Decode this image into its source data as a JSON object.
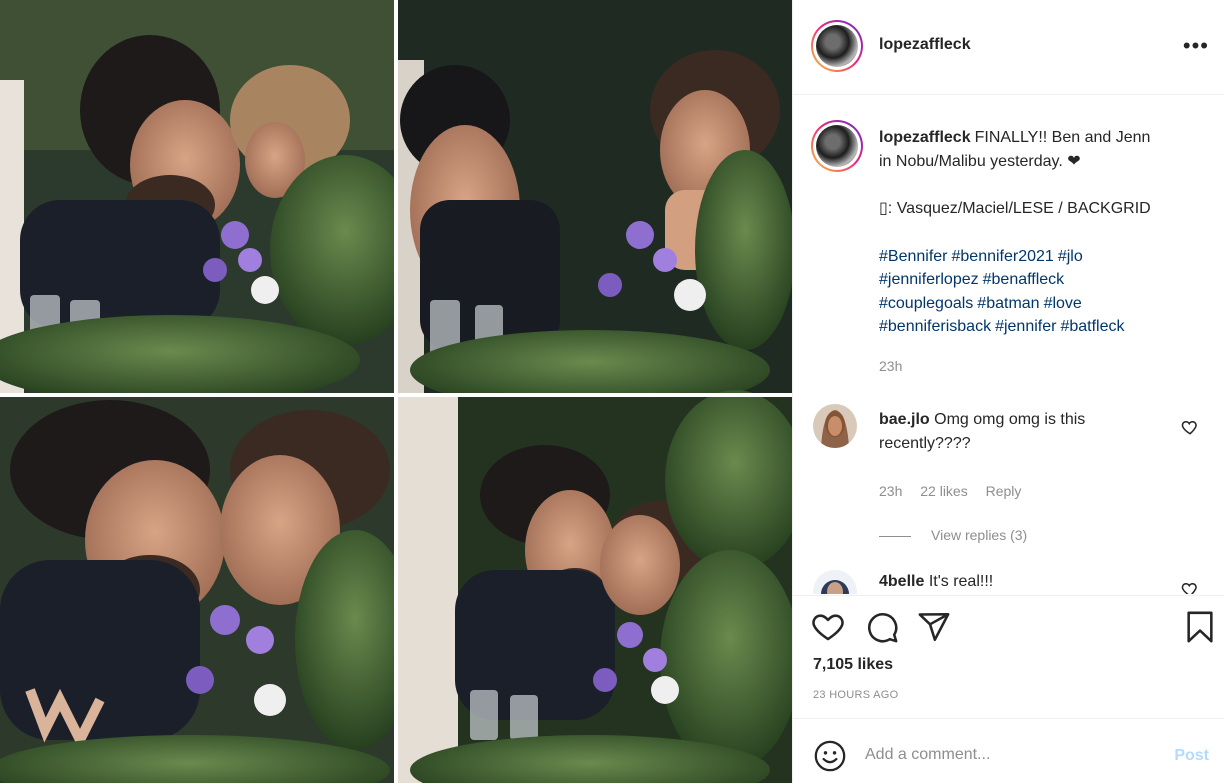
{
  "post": {
    "username": "lopezaffleck",
    "more_label": "•••",
    "caption_lines": [
      "FINALLY!! Ben and Jenn",
      "in Nobu/Malibu yesterday. ❤"
    ],
    "credit": "▯: Vasquez/Maciel/LESE / BACKGRID",
    "hashtag_lines": [
      [
        "#Bennifer",
        "#bennifer2021",
        "#jlo"
      ],
      [
        "#jenniferlopez",
        "#benaffleck"
      ],
      [
        "#couplegoals",
        "#batman",
        "#love"
      ],
      [
        "#benniferisback",
        "#jennifer",
        "#batfleck"
      ]
    ],
    "caption_time": "23h"
  },
  "comments": [
    {
      "username": "bae.jlo",
      "text": "Omg omg omg is this recently????",
      "time": "23h",
      "likes": "22 likes",
      "reply": "Reply",
      "view_replies": "View replies (3)"
    },
    {
      "username": "4belle",
      "text": "It's real!!!"
    }
  ],
  "actions": {
    "likes": "7,105 likes",
    "ago": "23 HOURS AGO",
    "icons": [
      "heart-icon",
      "comment-icon",
      "share-icon",
      "bookmark-icon"
    ]
  },
  "add_comment": {
    "placeholder": "Add a comment...",
    "post_label": "Post",
    "colors": {
      "post_disabled": "#b3dbff",
      "link": "#00376b",
      "meta": "#8e8e8e"
    }
  }
}
